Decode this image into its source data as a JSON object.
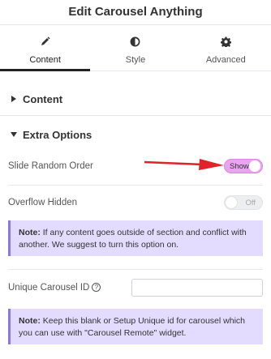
{
  "header": {
    "title": "Edit Carousel Anything"
  },
  "tabs": [
    {
      "label": "Content",
      "icon": "pencil-icon",
      "active": true
    },
    {
      "label": "Style",
      "icon": "contrast-icon",
      "active": false
    },
    {
      "label": "Advanced",
      "icon": "gear-icon",
      "active": false
    }
  ],
  "sections": {
    "content": {
      "title": "Content",
      "expanded": false
    },
    "extra": {
      "title": "Extra Options",
      "expanded": true
    }
  },
  "controls": {
    "slide_random": {
      "label": "Slide Random Order",
      "state": "Show",
      "on": true
    },
    "overflow_hidden": {
      "label": "Overflow Hidden",
      "state": "Off",
      "on": false
    },
    "note1": {
      "bold": "Note:",
      "text": " If any content goes outside of section and conflict with another. We suggest to turn this option on."
    },
    "unique_id": {
      "label": "Unique Carousel ID",
      "value": ""
    },
    "note2": {
      "bold": "Note:",
      "text": " Keep this blank or Setup Unique id for carousel which you can use with \"Carousel Remote\" widget."
    }
  },
  "colors": {
    "toggle_on": "#e9a3ef",
    "note_bg": "#e3dcff",
    "arrow": "#e0232a"
  }
}
